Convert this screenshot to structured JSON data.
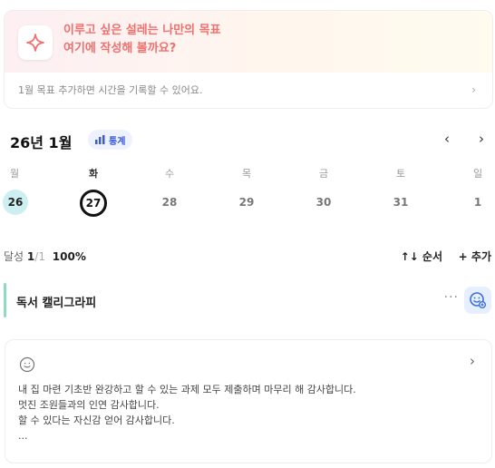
{
  "goal": {
    "title_line1": "이루고 싶은 설레는 나만의 목표",
    "title_line2": "여기에 작성해 볼까요?",
    "subtitle": "1월 목표  추가하면 시간을 기록할 수 있어요.",
    "arrow": "›",
    "icon": "sparkle-icon",
    "accent_color": "#f0706e"
  },
  "calendar": {
    "month_label": "26년 1월",
    "stats_label": "통계",
    "prev": "‹",
    "next": "›",
    "weekdays": [
      "월",
      "화",
      "수",
      "목",
      "금",
      "토",
      "일"
    ],
    "dates": [
      "26",
      "27",
      "28",
      "29",
      "30",
      "31",
      "1"
    ],
    "completed_index": 0,
    "today_index": 1
  },
  "progress": {
    "label": "달성",
    "count": "1",
    "total": "/1",
    "percent": "100%",
    "order_label": "↑↓ 순서",
    "add_label": "+ 추가"
  },
  "habit": {
    "name": "독서 캘리그라피",
    "more": "···",
    "color": "#8fd9c5"
  },
  "note": {
    "arrow": "›",
    "lines": [
      "내 집 마련 기초반 완강하고 할 수 있는 과제 모두 제출하며 마무리 해 감사합니다.",
      "멋진 조원들과의 인연 감사합니다.",
      "할 수 있다는 자신감 얻어 감사합니다.",
      "..."
    ]
  }
}
